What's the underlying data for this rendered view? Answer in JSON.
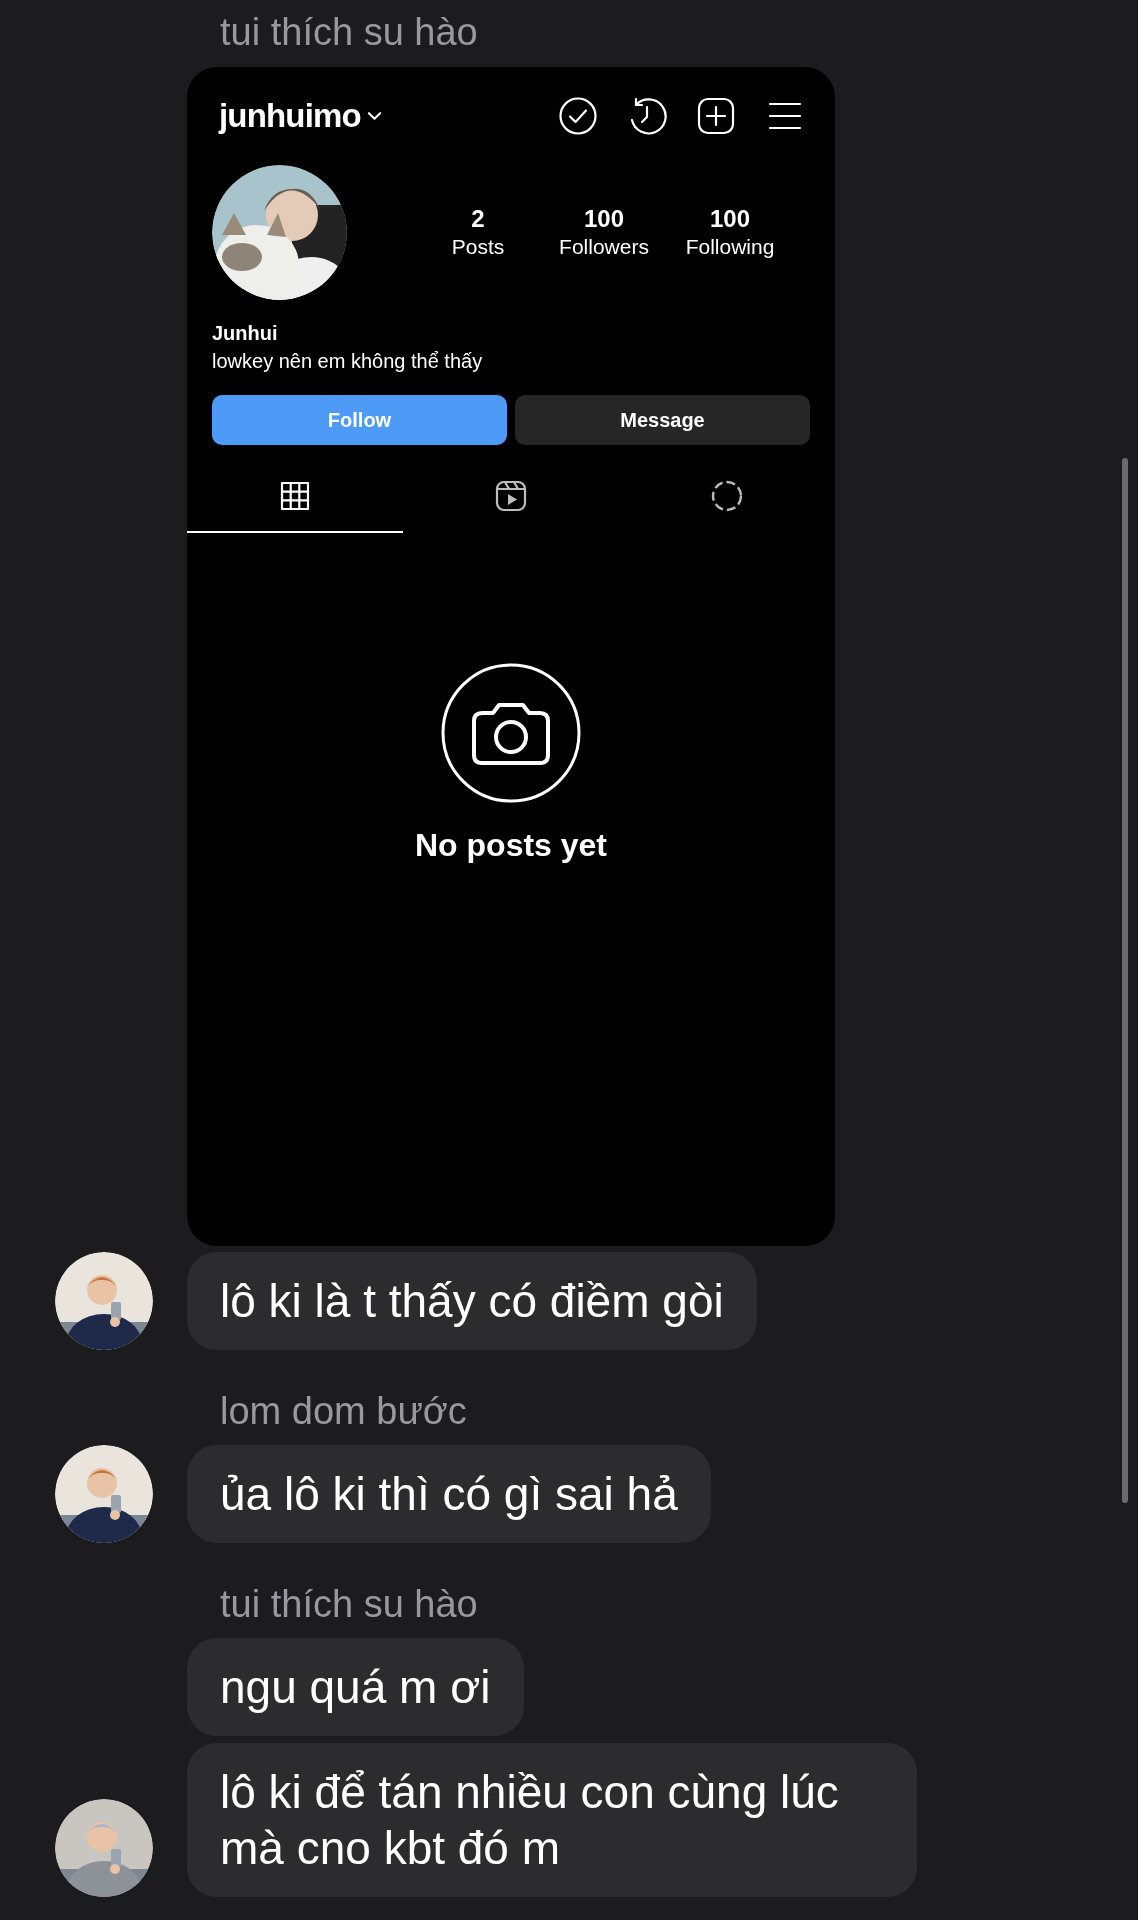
{
  "chat": [
    {
      "kind": "sender",
      "text": "tui thích su hào"
    },
    {
      "kind": "shared_profile",
      "profile": {
        "username": "junhuimo",
        "stats": [
          {
            "value": "2",
            "label": "Posts"
          },
          {
            "value": "100",
            "label": "Followers"
          },
          {
            "value": "100",
            "label": "Following"
          }
        ],
        "name": "Junhui",
        "bio": "lowkey nên em không thể thấy",
        "buttons": [
          {
            "label": "Follow",
            "kind": "primary"
          },
          {
            "label": "Message",
            "kind": "secondary"
          }
        ],
        "tabs": [
          {
            "kind": "grid",
            "selected": true
          },
          {
            "kind": "reels",
            "selected": false
          },
          {
            "kind": "tagged",
            "selected": false
          }
        ],
        "empty_text": "No posts yet"
      }
    },
    {
      "kind": "message",
      "text": "lô ki là t thấy có điềm gòi",
      "avatar": true
    },
    {
      "kind": "sender",
      "text": "lom dom bước"
    },
    {
      "kind": "message",
      "text": "ủa lô ki thì có gì sai hả",
      "avatar": true
    },
    {
      "kind": "sender",
      "text": "tui thích su hào"
    },
    {
      "kind": "message",
      "text": "ngu quá m ơi",
      "avatar": false
    },
    {
      "kind": "message",
      "text": "lô ki để tán nhiều con cùng lúc mà cno kbt đó m",
      "avatar": true
    }
  ]
}
